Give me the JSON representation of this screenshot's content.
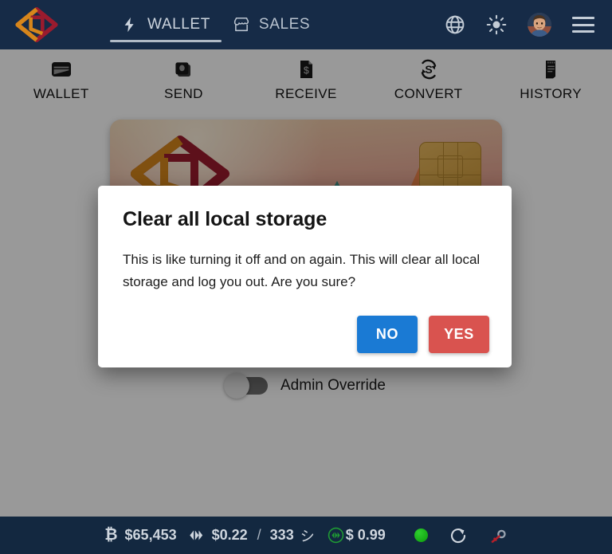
{
  "header": {
    "logo_icon": "brand-diamond-logo",
    "tabs": [
      {
        "label": "WALLET",
        "icon": "lightning-bolt-icon",
        "active": true
      },
      {
        "label": "SALES",
        "icon": "storefront-icon",
        "active": false
      }
    ],
    "actions": [
      {
        "name": "language-globe-icon"
      },
      {
        "name": "brightness-sun-icon"
      },
      {
        "name": "user-avatar"
      },
      {
        "name": "hamburger-menu-icon"
      }
    ]
  },
  "nav": {
    "items": [
      {
        "label": "WALLET",
        "icon": "wallet-icon"
      },
      {
        "label": "SEND",
        "icon": "send-cards-icon"
      },
      {
        "label": "RECEIVE",
        "icon": "invoice-dollar-icon"
      },
      {
        "label": "CONVERT",
        "icon": "convert-dollar-refresh-icon"
      },
      {
        "label": "HISTORY",
        "icon": "receipt-history-icon"
      }
    ]
  },
  "card": {
    "logo_icon": "brand-diamond-logo",
    "bitcoin_badge": "₿",
    "bolt_badge": "⚡",
    "chip_icon": "emv-chip-icon"
  },
  "toggle": {
    "label": "Admin Override",
    "state": "off"
  },
  "dialog": {
    "title": "Clear all local storage",
    "body": "This is like turning it off and on again. This will clear all local storage and log you out. Are you sure?",
    "buttons": {
      "no": "NO",
      "yes": "YES"
    },
    "colors": {
      "no": "#1a7ad4",
      "yes": "#d9534f"
    }
  },
  "footer": {
    "tickers": [
      {
        "icon": "bitcoin-icon",
        "symbol": "₿",
        "value": "$65,453"
      },
      {
        "icon": "dash-chevron-icon",
        "symbol": "",
        "value": "$0.22"
      },
      {
        "separator": "/"
      },
      {
        "value_sats": "333",
        "unit": "シ"
      },
      {
        "icon": "dash-circle-green-icon",
        "symbol": "",
        "value": "$ 0.99"
      }
    ],
    "bitcoin_price": "$65,453",
    "dash_price": "$0.22",
    "sats_amount": "333",
    "sats_unit": "シ",
    "separator": "/",
    "secondary_price": "$ 0.99",
    "status": {
      "connection_dot": "green",
      "refresh_icon": "refresh-icon",
      "key_icon": "key-icon"
    },
    "bg_color": "#132840"
  },
  "theme": {
    "header_bg": "#162b47",
    "overlay": "rgba(0,0,0,0.40)",
    "page_bg": "#ffffff"
  }
}
